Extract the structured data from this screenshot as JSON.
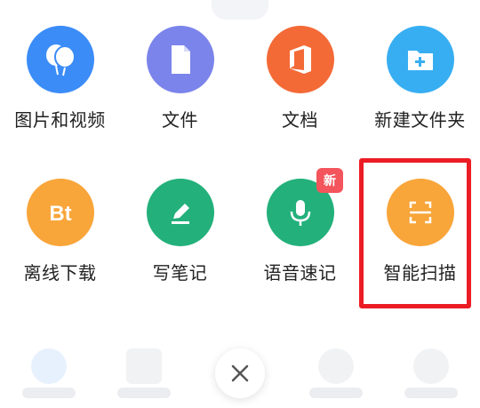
{
  "menu": {
    "items": [
      {
        "label": "图片和视频",
        "icon": "photos-balloon-icon",
        "color": "#3b8cf7"
      },
      {
        "label": "文件",
        "icon": "file-icon",
        "color": "#7b84ea"
      },
      {
        "label": "文档",
        "icon": "office-doc-icon",
        "color": "#f36a37"
      },
      {
        "label": "新建文件夹",
        "icon": "new-folder-icon",
        "color": "#38aef2"
      },
      {
        "label": "离线下载",
        "icon": "bt-download-icon",
        "color": "#f8a53a"
      },
      {
        "label": "写笔记",
        "icon": "pencil-note-icon",
        "color": "#23b07b"
      },
      {
        "label": "语音速记",
        "icon": "microphone-icon",
        "color": "#23b07b",
        "badge": "新"
      },
      {
        "label": "智能扫描",
        "icon": "scan-icon",
        "color": "#f8a53a"
      }
    ]
  },
  "bottom": {
    "close_icon": "close-icon",
    "close_color": "#555555"
  }
}
